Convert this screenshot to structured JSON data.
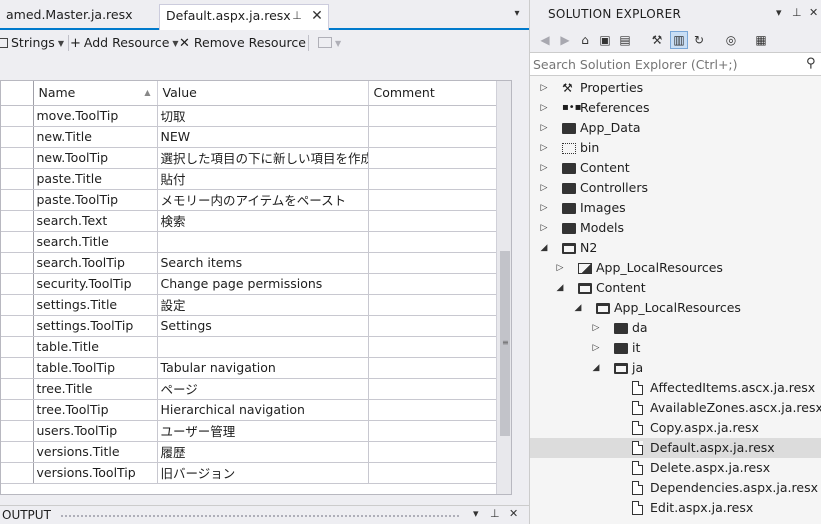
{
  "tabs": {
    "inactive": "amed.Master.ja.resx",
    "active": "Default.aspx.ja.resx"
  },
  "toolbar": {
    "strings": "Strings",
    "add_resource": "Add Resource",
    "remove_resource": "Remove Resource"
  },
  "grid": {
    "headers": {
      "name": "Name",
      "value": "Value",
      "comment": "Comment"
    },
    "rows": [
      {
        "name": "move.ToolTip",
        "value": "切取",
        "comment": ""
      },
      {
        "name": "new.Title",
        "value": "NEW",
        "comment": ""
      },
      {
        "name": "new.ToolTip",
        "value": "選択した項目の下に新しい項目を作成",
        "comment": ""
      },
      {
        "name": "paste.Title",
        "value": "貼付",
        "comment": ""
      },
      {
        "name": "paste.ToolTip",
        "value": "メモリー内のアイテムをペースト",
        "comment": ""
      },
      {
        "name": "search.Text",
        "value": "検索",
        "comment": ""
      },
      {
        "name": "search.Title",
        "value": "",
        "comment": ""
      },
      {
        "name": "search.ToolTip",
        "value": "Search items",
        "comment": ""
      },
      {
        "name": "security.ToolTip",
        "value": "Change page permissions",
        "comment": ""
      },
      {
        "name": "settings.Title",
        "value": "設定",
        "comment": ""
      },
      {
        "name": "settings.ToolTip",
        "value": "Settings",
        "comment": ""
      },
      {
        "name": "table.Title",
        "value": "",
        "comment": ""
      },
      {
        "name": "table.ToolTip",
        "value": "Tabular navigation",
        "comment": ""
      },
      {
        "name": "tree.Title",
        "value": "ページ",
        "comment": ""
      },
      {
        "name": "tree.ToolTip",
        "value": "Hierarchical navigation",
        "comment": ""
      },
      {
        "name": "users.ToolTip",
        "value": "ユーザー管理",
        "comment": ""
      },
      {
        "name": "versions.Title",
        "value": "履歴",
        "comment": ""
      },
      {
        "name": "versions.ToolTip",
        "value": "旧バージョン",
        "comment": ""
      }
    ]
  },
  "output": {
    "title": "OUTPUT"
  },
  "solution_explorer": {
    "title": "SOLUTION EXPLORER",
    "search_placeholder": "Search Solution Explorer (Ctrl+;)",
    "nodes": [
      {
        "label": "Properties",
        "icon": "wrench-icon",
        "level": 0,
        "expander": "collapsed"
      },
      {
        "label": "References",
        "icon": "references-icon",
        "level": 0,
        "expander": "collapsed"
      },
      {
        "label": "App_Data",
        "icon": "folder-icon",
        "level": 0,
        "expander": "collapsed"
      },
      {
        "label": "bin",
        "icon": "dotted-folder-icon",
        "level": 0,
        "expander": "collapsed"
      },
      {
        "label": "Content",
        "icon": "folder-icon",
        "level": 0,
        "expander": "collapsed"
      },
      {
        "label": "Controllers",
        "icon": "folder-icon",
        "level": 0,
        "expander": "collapsed"
      },
      {
        "label": "Images",
        "icon": "folder-icon",
        "level": 0,
        "expander": "collapsed"
      },
      {
        "label": "Models",
        "icon": "folder-icon",
        "level": 0,
        "expander": "collapsed"
      },
      {
        "label": "N2",
        "icon": "open-folder-icon",
        "level": 0,
        "expander": "expanded"
      },
      {
        "label": "App_LocalResources",
        "icon": "image-folder-icon",
        "level": 1,
        "expander": "collapsed"
      },
      {
        "label": "Content",
        "icon": "open-folder-icon",
        "level": 1,
        "expander": "expanded"
      },
      {
        "label": "App_LocalResources",
        "icon": "open-folder-icon",
        "level": 2,
        "expander": "expanded"
      },
      {
        "label": "da",
        "icon": "folder-icon",
        "level": 3,
        "expander": "collapsed"
      },
      {
        "label": "it",
        "icon": "folder-icon",
        "level": 3,
        "expander": "collapsed"
      },
      {
        "label": "ja",
        "icon": "open-folder-icon",
        "level": 3,
        "expander": "expanded"
      },
      {
        "label": "AffectedItems.ascx.ja.resx",
        "icon": "resx-file-icon",
        "level": 4,
        "expander": "none"
      },
      {
        "label": "AvailableZones.ascx.ja.resx",
        "icon": "resx-file-icon",
        "level": 4,
        "expander": "none"
      },
      {
        "label": "Copy.aspx.ja.resx",
        "icon": "resx-file-icon",
        "level": 4,
        "expander": "none"
      },
      {
        "label": "Default.aspx.ja.resx",
        "icon": "resx-file-icon",
        "level": 4,
        "expander": "none",
        "selected": true
      },
      {
        "label": "Delete.aspx.ja.resx",
        "icon": "resx-file-icon",
        "level": 4,
        "expander": "none"
      },
      {
        "label": "Dependencies.aspx.ja.resx",
        "icon": "resx-file-icon",
        "level": 4,
        "expander": "none"
      },
      {
        "label": "Edit.aspx.ja.resx",
        "icon": "resx-file-icon",
        "level": 4,
        "expander": "none"
      }
    ]
  }
}
